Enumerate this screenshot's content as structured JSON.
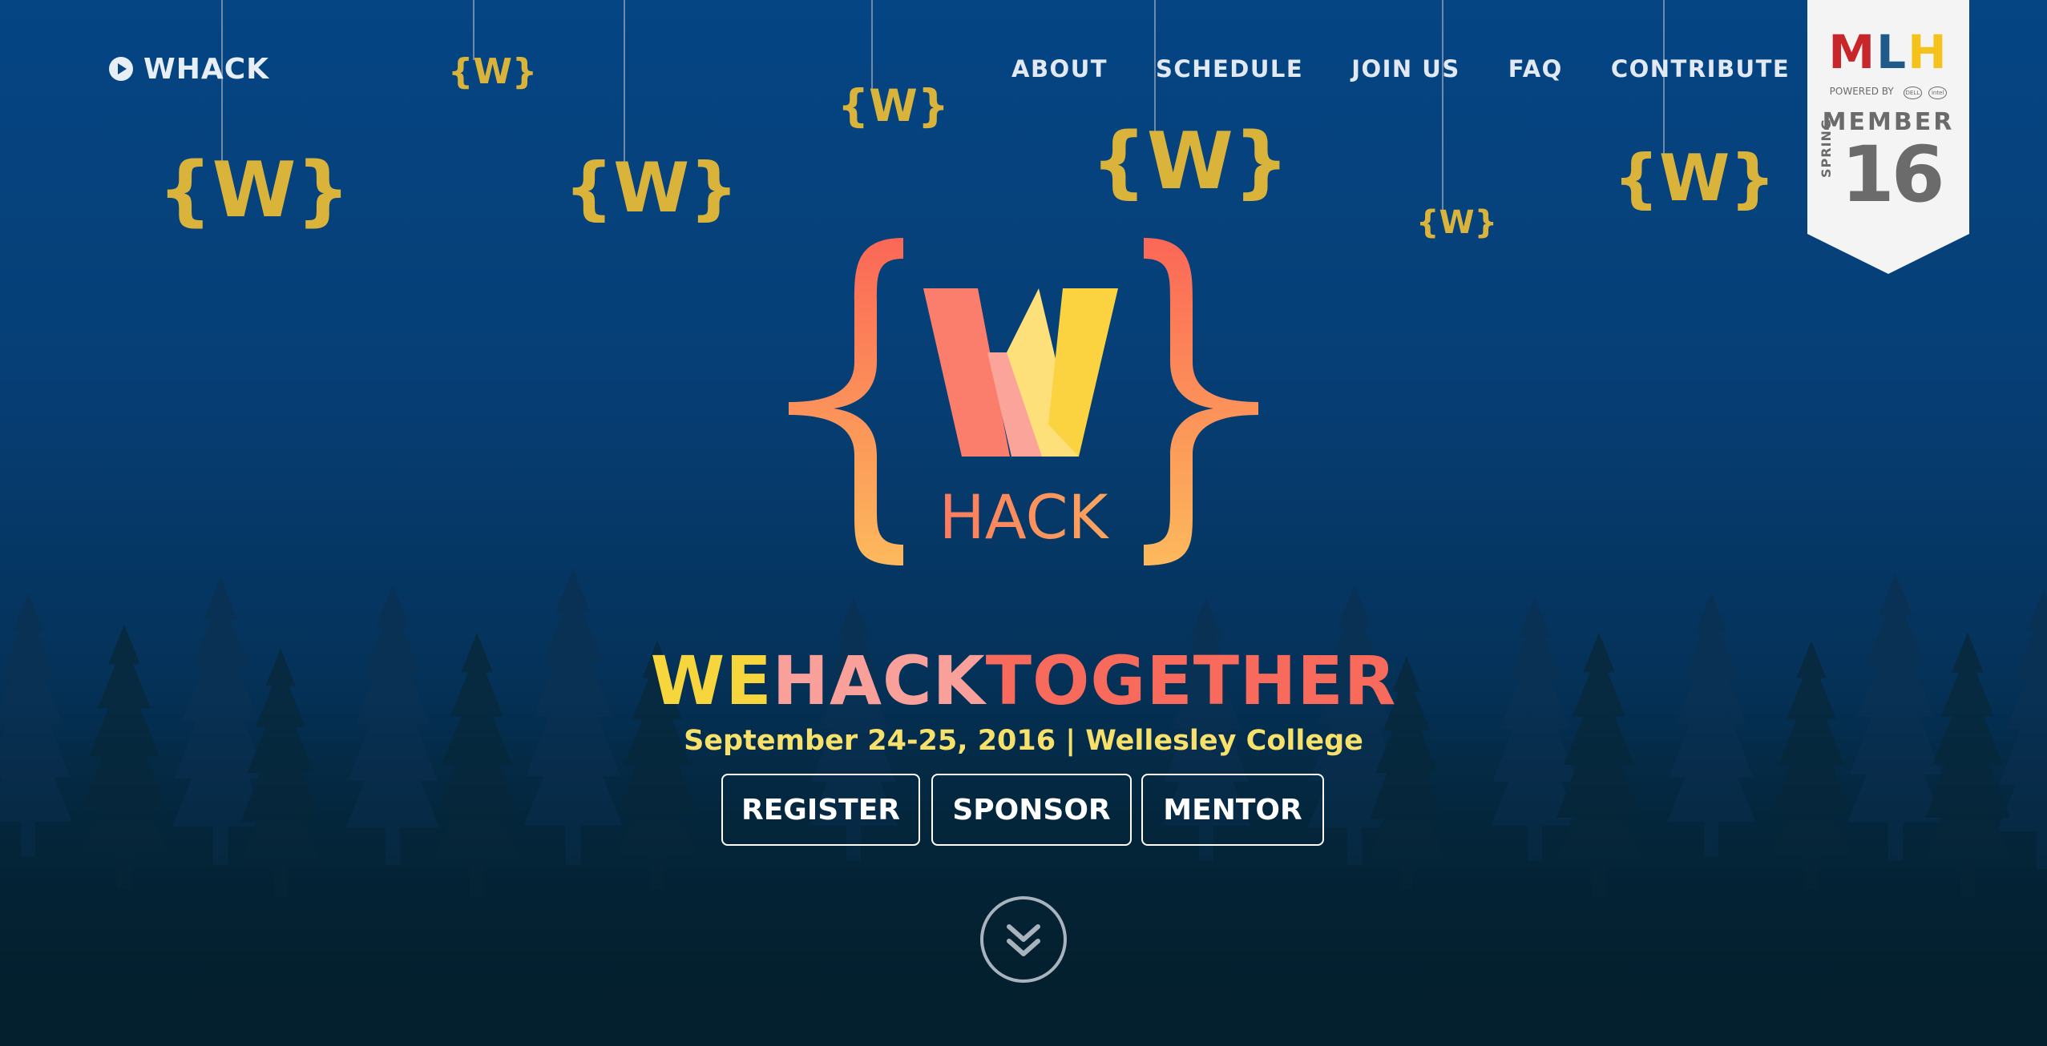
{
  "nav": {
    "brand": "WHACK",
    "links": [
      "ABOUT",
      "SCHEDULE",
      "JOIN US",
      "FAQ",
      "CONTRIBUTE"
    ]
  },
  "logo": {
    "letter": "W",
    "word": "HACK"
  },
  "hanging_ornament_text": "{W}",
  "headline": {
    "part1": "WE",
    "part2": "HACK",
    "part3": "TOGETHER"
  },
  "subline": "September 24-25, 2016 | Wellesley College",
  "buttons": {
    "register": "REGISTER",
    "sponsor": "SPONSOR",
    "mentor": "MENTOR"
  },
  "mlh_badge": {
    "logo": "MLH",
    "powered_by": "POWERED BY",
    "sponsor_logo_1": "DELL",
    "sponsor_logo_2": "intel",
    "member": "MEMBER",
    "season": "SPRING",
    "year": "16"
  },
  "colors": {
    "headline_we": "#f7d63d",
    "headline_hack": "#f9a09a",
    "headline_together": "#f86a5b",
    "subline": "#f7e16b",
    "ornament": "#d9b33a",
    "logo_coral": "#fb6f5d",
    "logo_orange": "#fdb75b"
  },
  "icons": {
    "brand": "play-circle-icon",
    "scroll": "double-chevron-down-icon"
  }
}
